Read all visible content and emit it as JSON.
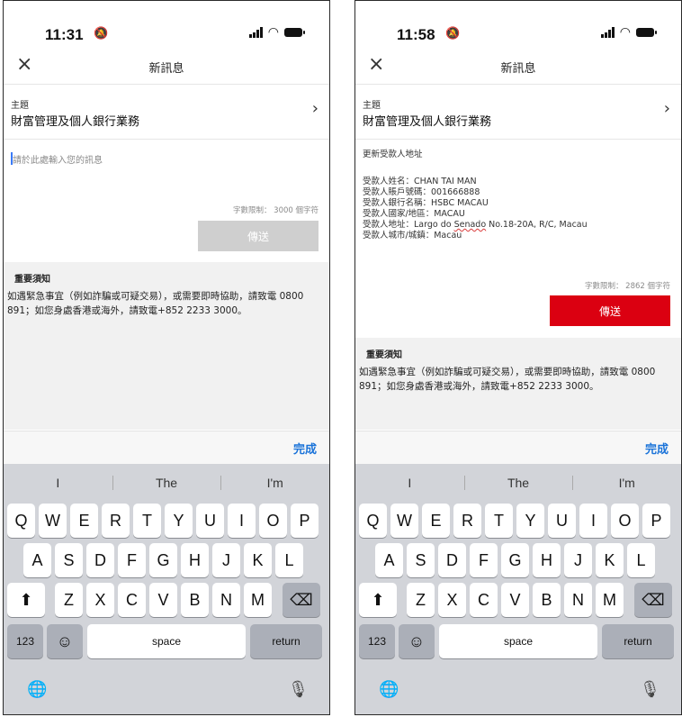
{
  "left": {
    "status": {
      "time": "11:31"
    },
    "nav": {
      "title": "新訊息",
      "close": "×"
    },
    "subject": {
      "label": "主題",
      "value": "財富管理及個人銀行業務",
      "chevron": "›"
    },
    "message": {
      "placeholder": "請於此處輸入您的訊息"
    },
    "count": "字數限制： 3000 個字符",
    "send": "傳送",
    "notice": {
      "title": "重要須知",
      "text": "如遇緊急事宜（例如詐騙或可疑交易），或需要即時協助，請致電 0800 891；如您身處香港或海外，請致電+852 2233 3000。"
    },
    "done": "完成"
  },
  "right": {
    "status": {
      "time": "11:58"
    },
    "nav": {
      "title": "新訊息",
      "close": "×"
    },
    "subject": {
      "label": "主題",
      "value": "財富管理及個人銀行業務",
      "chevron": "›"
    },
    "message": {
      "heading": "更新受款人地址",
      "lines": [
        "受款人姓名：CHAN TAI MAN",
        "受款人賬戶號碼：001666888",
        "受款人銀行名稱：HSBC MACAU",
        "受款人國家/地區：MACAU"
      ],
      "address_prefix": "受款人地址：Largo do ",
      "address_misspelled": "Senado",
      "address_suffix": " No.18-20A, R/C, Macau",
      "city": "受款人城市/城鎮：Macau"
    },
    "count": "字數限制： 2862 個字符",
    "send": "傳送",
    "notice": {
      "title": "重要須知",
      "text": "如遇緊急事宜（例如詐騙或可疑交易），或需要即時協助，請致電 0800 891；如您身處香港或海外，請致電+852 2233 3000。"
    },
    "done": "完成"
  },
  "keyboard": {
    "suggestions": [
      "I",
      "The",
      "I'm"
    ],
    "row1": [
      "Q",
      "W",
      "E",
      "R",
      "T",
      "Y",
      "U",
      "I",
      "O",
      "P"
    ],
    "row2": [
      "A",
      "S",
      "D",
      "F",
      "G",
      "H",
      "J",
      "K",
      "L"
    ],
    "row3": [
      "Z",
      "X",
      "C",
      "V",
      "B",
      "N",
      "M"
    ],
    "shift": "⬆",
    "backspace": "⌫",
    "numbers": "123",
    "emoji": "☺",
    "space": "space",
    "return": "return",
    "globe": "🌐",
    "mic": "🎙"
  },
  "colors": {
    "accent_red": "#db0011",
    "link_blue": "#1a73d9"
  }
}
